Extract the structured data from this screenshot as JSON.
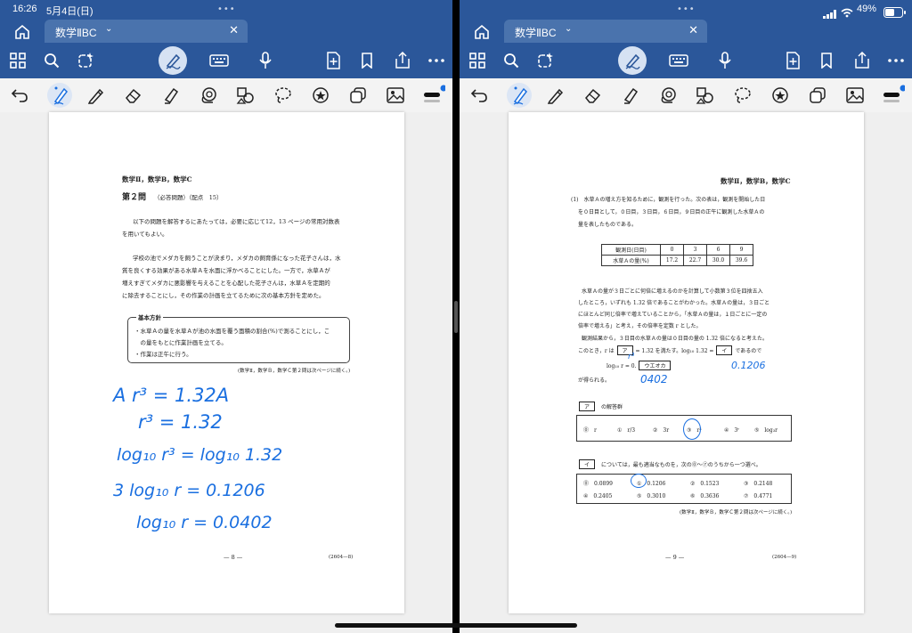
{
  "status": {
    "time": "16:26",
    "date": "5月4日(日)",
    "battery": "49%",
    "dots": "•••"
  },
  "tab": {
    "label": "数学ⅡBC",
    "chevron": "⌄",
    "close": "✕"
  },
  "toolbar_icons": [
    "grid-icon",
    "search-icon",
    "ai-icon",
    "draw-icon",
    "keyboard-icon",
    "microphone-icon",
    "add-page-icon",
    "bookmark-icon",
    "share-icon",
    "more-icon"
  ],
  "ink_tools": [
    "undo-icon",
    "pen-icon",
    "pencil-icon",
    "eraser-icon",
    "highlighter-icon",
    "lasso-icon",
    "shapes-icon",
    "select-icon",
    "stamp-icon",
    "copy-icon",
    "image-icon",
    "stroke-width-icon"
  ],
  "accent": "#2b579a",
  "left_page": {
    "header": "数学Ⅱ，数学B，数学C",
    "q_title": "第２問",
    "q_note": "（必答問題）（配点　15）",
    "intro1": "以下の問題を解答するにあたっては，必要に応じて12，13 ページの常用対数表",
    "intro2": "を用いてもよい。",
    "p1": "学校の池でメダカを飼うことが決まり，メダカの飼育係になった花子さんは，水",
    "p2": "質を良くする効果がある水草Ａを水面に浮かべることにした。一方で，水草Ａが",
    "p3": "増えすぎてメダカに悪影響を与えることを心配した花子さんは，水草Ａを定期的",
    "p4": "に除去することにし，その作業の計画を立てるために次の基本方針を定めた。",
    "box_title": "基本方針",
    "b1": "・水草Ａの量を水草Ａが池の水面を覆う面積の割合(%)で測ることにし，こ",
    "b2": "　の量をもとに作業計画を立てる。",
    "b3": "・作業は正午に行う。",
    "cont": "(数学Ⅱ，数学Ｂ，数学Ｃ第２問は次ページに続く。)",
    "page_num": "— 8 —",
    "code": "(2604—8)",
    "hw1": "A r³ = 1.32A",
    "hw2": "r³ = 1.32",
    "hw3": "log₁₀ r³ = log₁₀ 1.32",
    "hw4": "3 log₁₀ r = 0.1206",
    "hw5": "log₁₀ r = 0.0402"
  },
  "right_page": {
    "header": "数学Ⅱ，数学B，数学C",
    "q1a": "(1)　水草Ａの増え方を知るために，観測を行った。次の表は，観測を開始した日",
    "q1b": "を０日目として，０日目，３日目，６日目，９日目の正午に観測した水草Ａの",
    "q1c": "量を表したものである。",
    "table": {
      "h1": "観測日(日目)",
      "h2": "水草Ａの量(%)",
      "days": [
        "0",
        "3",
        "6",
        "9"
      ],
      "amounts": [
        "17.2",
        "22.7",
        "30.0",
        "39.6"
      ]
    },
    "t1": "水草Ａの量が３日ごとに何倍に増えるのかを計算して小数第３位を四捨五入",
    "t2": "したところ，いずれも 1.32 倍であることがわかった。水草Ａの量は，３日ごと",
    "t3": "にほとんど同じ倍率で増えていることから，「水草Ａの量は，１日ごとに一定の",
    "t4": "倍率で増える」と考え，その倍率を定数 r とした。",
    "t5": "観測結果から，３日目の水草Ａの量は０日目の量の 1.32 倍になると考えた。",
    "t6a": "このとき，r は",
    "t6b": "ア",
    "t6c": "= 1.32 を満たす。log₁₀ 1.32 =",
    "t6d": "イ",
    "t6e": "であるので",
    "t7a": "log₁₀ r = 0.",
    "t7b": "ウエオカ",
    "t8": "が得られる。",
    "a_label": "ア",
    "a_group": "の解答群",
    "a_choices": [
      "⓪　r",
      "①　r/3",
      "②　3r",
      "③　r³",
      "④　3ʳ",
      "⑤　log₃r"
    ],
    "i_label": "イ",
    "i_text": "については，最も適当なものを，次の⓪～⑦のうちから一つ選べ。",
    "i_row1": [
      "⓪　0.0899",
      "①　0.1206",
      "②　0.1523",
      "③　0.2148"
    ],
    "i_row2": [
      "④　0.2405",
      "⑤　0.3010",
      "⑥　0.3636",
      "⑦　0.4771"
    ],
    "cont": "(数学Ⅱ，数学Ｂ，数学Ｃ第２問は次ページに続く。)",
    "page_num": "— 9 —",
    "code": "(2604—9)",
    "hw_r3": "r³",
    "hw_val": "0.1206",
    "hw_0402": "0402"
  }
}
